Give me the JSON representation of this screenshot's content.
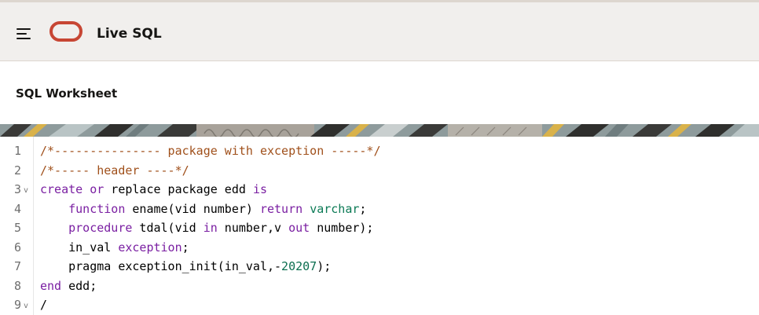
{
  "header": {
    "app_title": "Live SQL",
    "menu_icon": "hamburger-menu-icon",
    "logo": "oracle-logo"
  },
  "page": {
    "title": "SQL Worksheet"
  },
  "colors": {
    "header_bg": "#f1efed",
    "logo": "#c74634",
    "comment": "#a0501b",
    "keyword": "#7a1fa2",
    "type": "#0b7a55",
    "number": "#0b6e4f"
  },
  "editor": {
    "lines": [
      {
        "num": "1",
        "fold": "",
        "tokens": [
          {
            "t": "/*--------------- package with exception -----*/",
            "k": "comment"
          }
        ]
      },
      {
        "num": "2",
        "fold": "",
        "tokens": [
          {
            "t": "/*----- header ----*/",
            "k": "comment"
          }
        ]
      },
      {
        "num": "3",
        "fold": "v",
        "tokens": [
          {
            "t": "create",
            "k": "keyword"
          },
          {
            "t": " ",
            "k": "plain"
          },
          {
            "t": "or",
            "k": "keyword"
          },
          {
            "t": " replace package edd ",
            "k": "plain"
          },
          {
            "t": "is",
            "k": "keyword"
          }
        ]
      },
      {
        "num": "4",
        "fold": "",
        "tokens": [
          {
            "t": "    ",
            "k": "plain"
          },
          {
            "t": "function",
            "k": "keyword"
          },
          {
            "t": " ename(vid number) ",
            "k": "plain"
          },
          {
            "t": "return",
            "k": "keyword"
          },
          {
            "t": " ",
            "k": "plain"
          },
          {
            "t": "varchar",
            "k": "type"
          },
          {
            "t": ";",
            "k": "plain"
          }
        ]
      },
      {
        "num": "5",
        "fold": "",
        "tokens": [
          {
            "t": "    ",
            "k": "plain"
          },
          {
            "t": "procedure",
            "k": "keyword"
          },
          {
            "t": " tdal(vid ",
            "k": "plain"
          },
          {
            "t": "in",
            "k": "keyword"
          },
          {
            "t": " number,v ",
            "k": "plain"
          },
          {
            "t": "out",
            "k": "keyword"
          },
          {
            "t": " number);",
            "k": "plain"
          }
        ]
      },
      {
        "num": "6",
        "fold": "",
        "tokens": [
          {
            "t": "    in_val ",
            "k": "plain"
          },
          {
            "t": "exception",
            "k": "keyword"
          },
          {
            "t": ";",
            "k": "plain"
          }
        ]
      },
      {
        "num": "7",
        "fold": "",
        "tokens": [
          {
            "t": "    pragma exception_init(in_val,-",
            "k": "plain"
          },
          {
            "t": "20207",
            "k": "number"
          },
          {
            "t": ");",
            "k": "plain"
          }
        ]
      },
      {
        "num": "8",
        "fold": "",
        "tokens": [
          {
            "t": "end",
            "k": "keyword"
          },
          {
            "t": " edd;",
            "k": "plain"
          }
        ]
      },
      {
        "num": "9",
        "fold": "v",
        "tokens": [
          {
            "t": "/",
            "k": "plain"
          }
        ]
      }
    ]
  }
}
